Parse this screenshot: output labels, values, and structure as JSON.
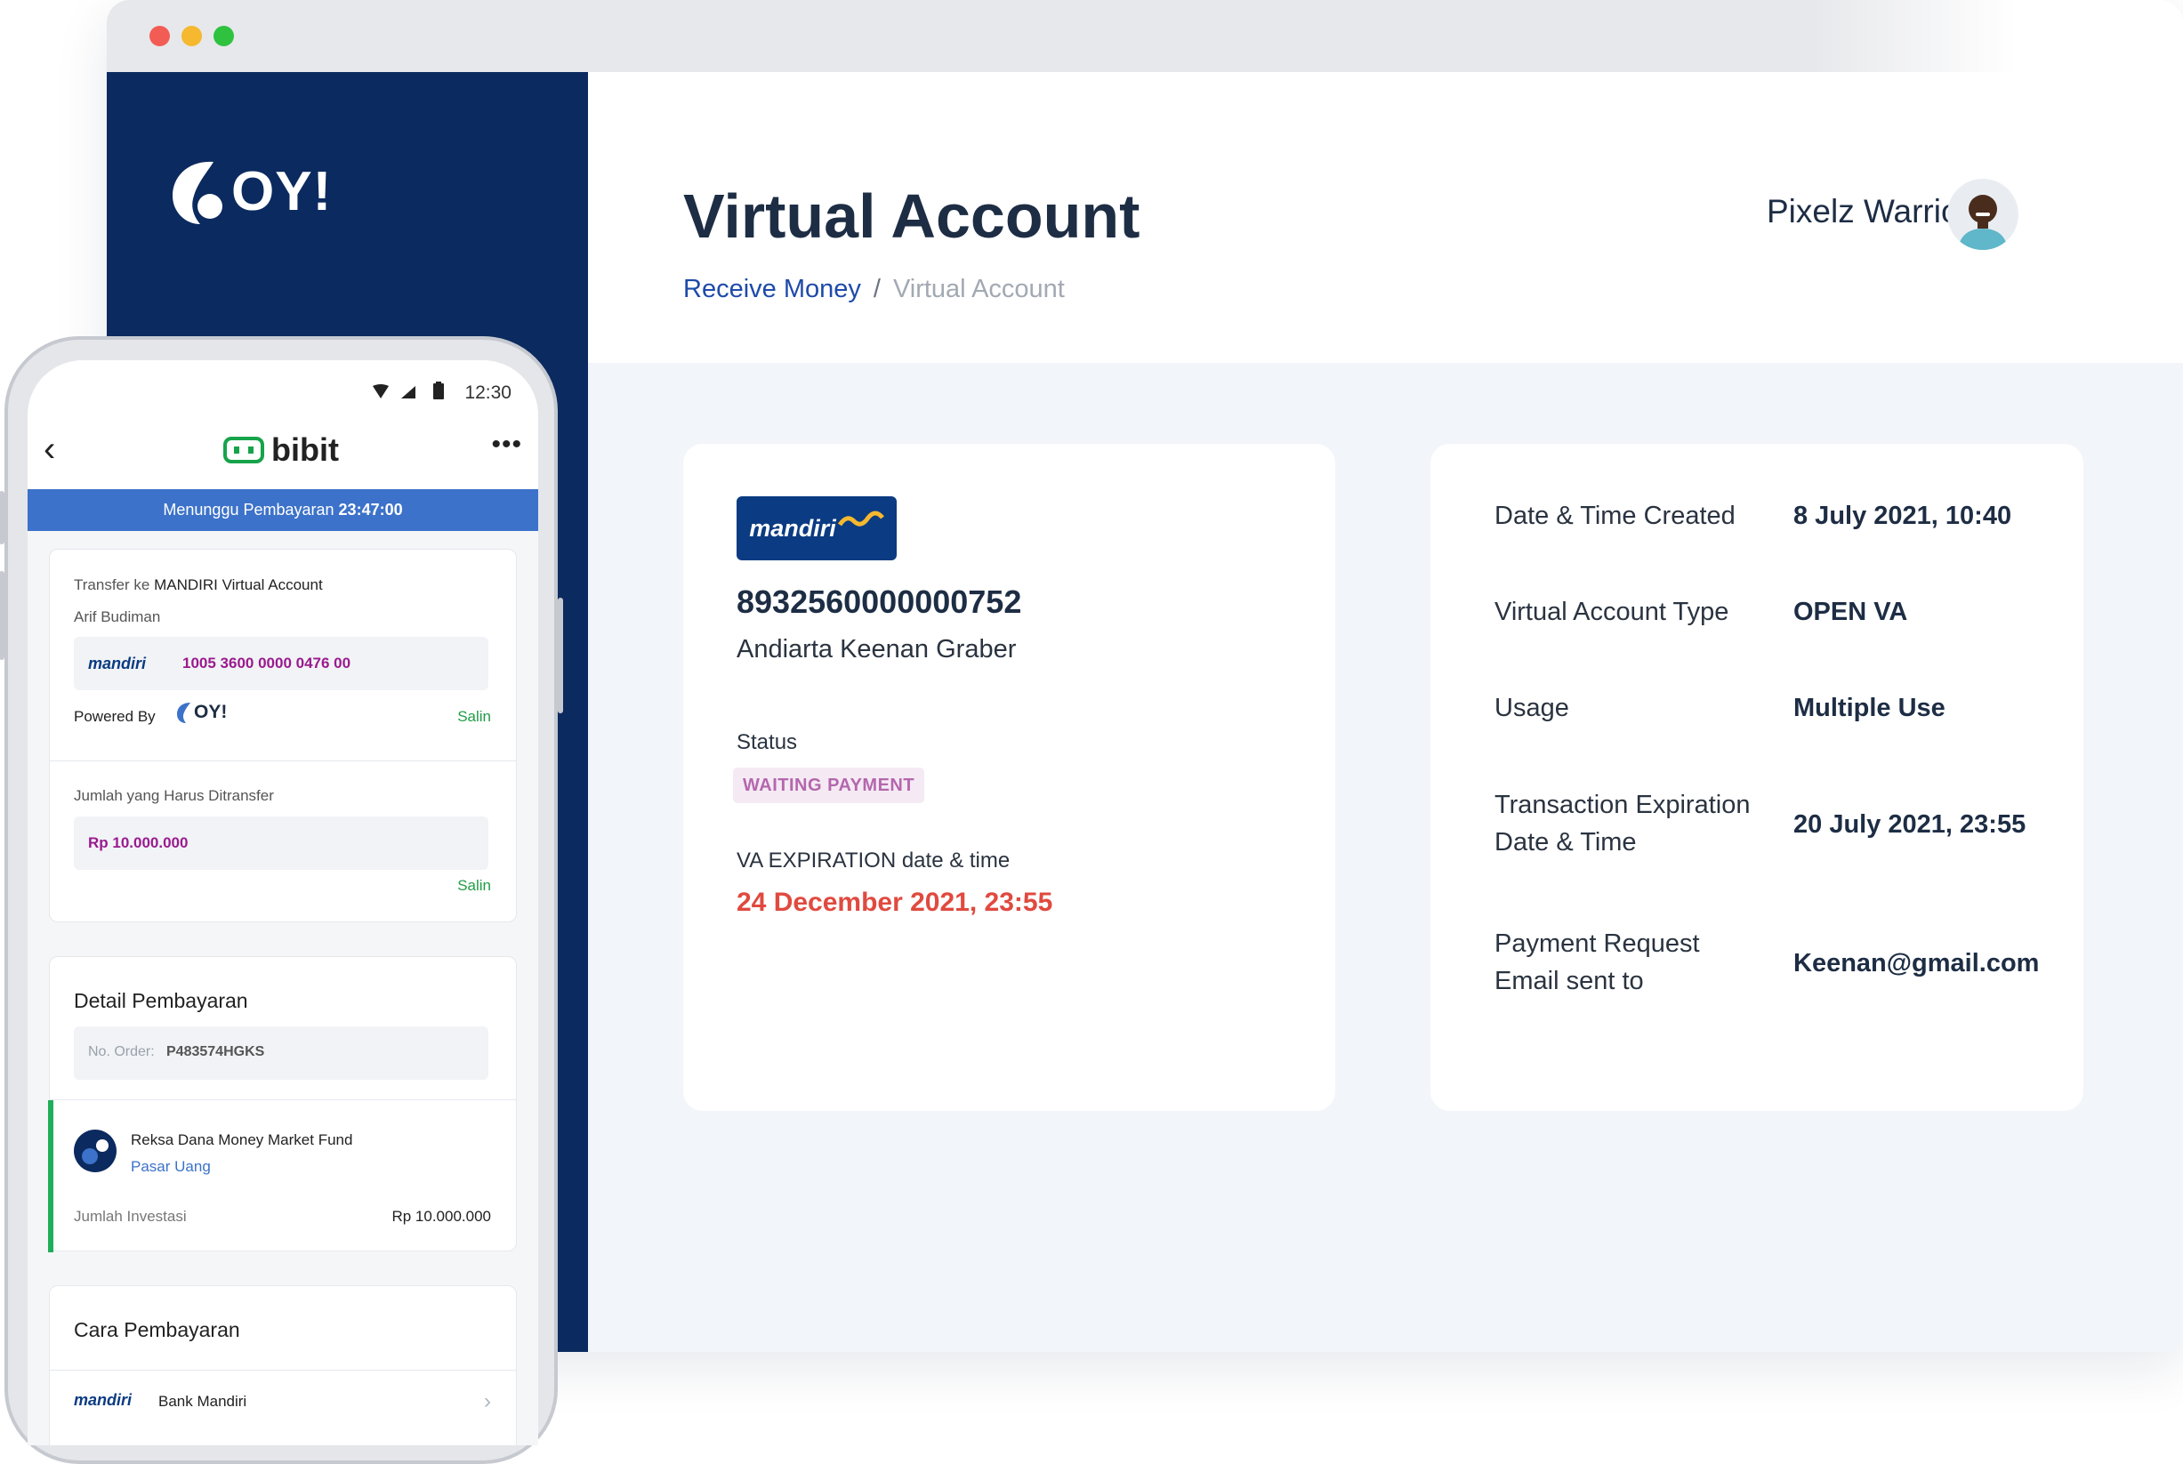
{
  "window": {
    "controls": [
      "close",
      "minimize",
      "maximize"
    ]
  },
  "brand": {
    "logo_text": "OY!"
  },
  "header": {
    "title": "Virtual Account",
    "breadcrumb": {
      "parent": "Receive Money",
      "separator": "/",
      "current": "Virtual Account"
    },
    "user_name": "Pixelz Warrios"
  },
  "va_card": {
    "bank_logo_text": "mandiri",
    "va_number": "8932560000000752",
    "account_name": "Andiarta Keenan Graber",
    "status_label": "Status",
    "status_value": "WAITING PAYMENT",
    "expiration_label": "VA EXPIRATION date & time",
    "expiration_value": "24 December 2021, 23:55"
  },
  "details": [
    {
      "label": "Date & Time Created",
      "value": "8 July 2021, 10:40"
    },
    {
      "label": "Virtual Account Type",
      "value": "OPEN VA"
    },
    {
      "label": "Usage",
      "value": "Multiple Use"
    },
    {
      "label": "Transaction Expiration Date & Time",
      "value": "20 July 2021, 23:55"
    },
    {
      "label": "Payment Request Email sent to",
      "value": "Keenan@gmail.com"
    }
  ],
  "phone": {
    "status_time": "12:30",
    "app_name": "bibit",
    "banner_prefix": "Menunggu Pembayaran",
    "banner_time": "23:47:00",
    "transfer": {
      "label_prefix": "Transfer ke",
      "label_bank": "MANDIRI Virtual Account",
      "account_holder": "Arif Budiman",
      "bank_logo_text": "mandiri",
      "va_number": "1005 3600 0000 0476 00",
      "powered_by": "Powered By",
      "powered_logo": "OY!",
      "copy_label": "Salin"
    },
    "amount": {
      "label": "Jumlah yang Harus Ditransfer",
      "value": "Rp 10.000.000",
      "copy_label": "Salin"
    },
    "detail": {
      "title": "Detail Pembayaran",
      "order_label": "No. Order:",
      "order_value": "P483574HGKS",
      "fund_name": "Reksa Dana Money Market Fund",
      "fund_type": "Pasar Uang",
      "investment_label": "Jumlah Investasi",
      "investment_value": "Rp 10.000.000"
    },
    "payment_method": {
      "title": "Cara Pembayaran",
      "bank_logo_text": "mandiri",
      "bank_name": "Bank Mandiri"
    }
  },
  "colors": {
    "sidebar": "#0b2a5f",
    "breadcrumb_link": "#1e4aa8",
    "status_badge_text": "#b467ad",
    "expiration_red": "#e04a3f",
    "phone_banner": "#3c72c9",
    "amount_purple": "#9a1a8e",
    "copy_green": "#1f9d46"
  }
}
